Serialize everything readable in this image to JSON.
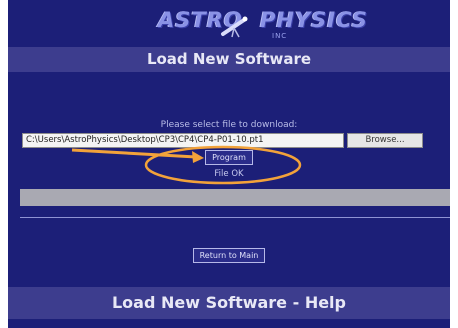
{
  "logo": {
    "word_left": "ASTRO",
    "word_right": "PHYSICS",
    "sub": "INC",
    "icon": "telescope-icon",
    "color": "#8a92e6"
  },
  "header": {
    "title": "Load New Software"
  },
  "upload": {
    "prompt": "Please select file to download:",
    "file_path": "C:\\Users\\AstroPhysics\\Desktop\\CP3\\CP4\\CP4-P01-10.pt1",
    "browse_label": "Browse...",
    "program_label": "Program",
    "status": "File OK"
  },
  "progress": {
    "fraction": 0.0
  },
  "footer": {
    "return_label": "Return to Main",
    "help_title": "Load New Software - Help"
  },
  "annotation": {
    "type": "arrow-and-ellipse",
    "color": "#f2a23a"
  },
  "colors": {
    "background": "#1c1f78",
    "band": "#3d3d8e",
    "progress_track": "#a9a9b2"
  }
}
